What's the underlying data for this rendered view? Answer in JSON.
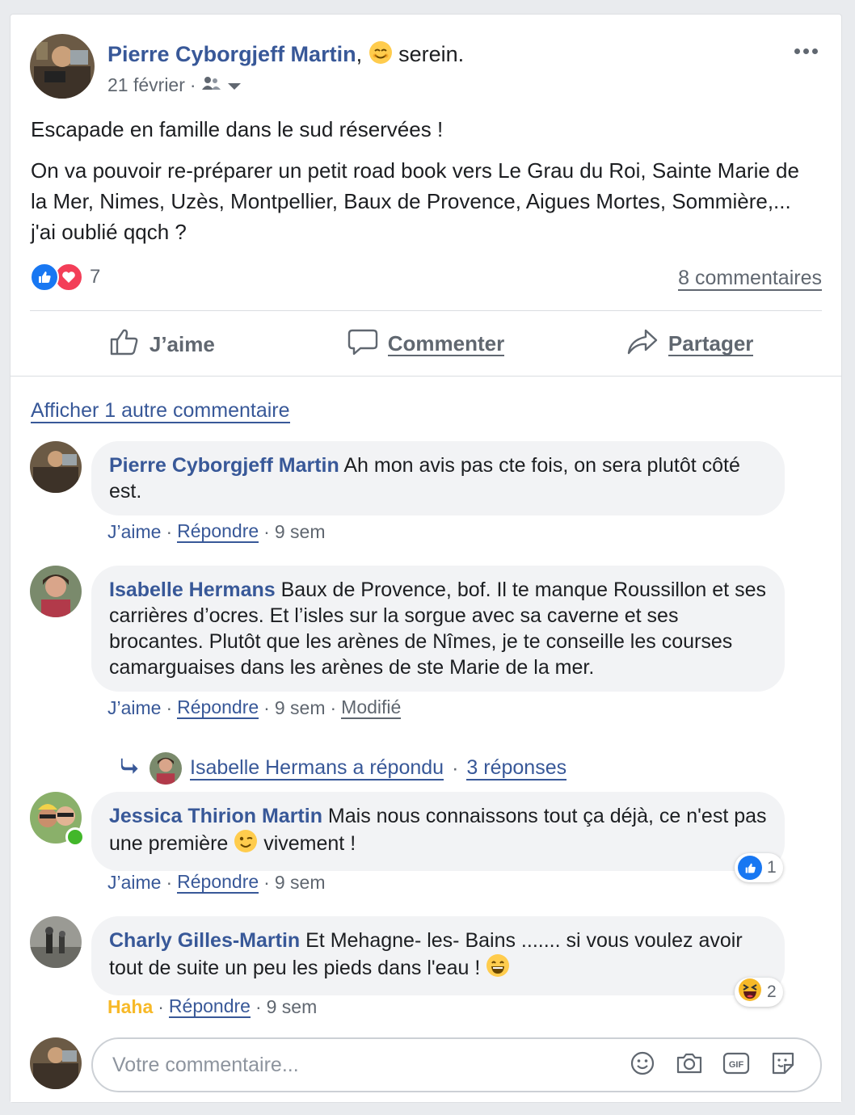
{
  "post": {
    "author": "Pierre Cyborgjeff Martin",
    "separator": ",",
    "feeling": "serein.",
    "date": "21 février",
    "dot": "·",
    "text_1": "Escapade en famille dans le sud réservées !",
    "text_2": "On va pouvoir re-préparer un petit road book vers Le Grau du Roi, Sainte Marie de la Mer, Nimes, Uzès, Montpellier, Baux de Provence, Aigues Mortes, Sommière,... j'ai oublié qqch ?",
    "reaction_count": "7",
    "comments_count": "8 commentaires"
  },
  "actions": {
    "like": "J’aime",
    "comment": "Commenter",
    "share": "Partager"
  },
  "show_more": "Afficher 1 autre commentaire",
  "comments": [
    {
      "author": "Pierre Cyborgjeff Martin",
      "text": "Ah mon avis pas cte fois, on sera plutôt côté est.",
      "like": "J’aime",
      "reply": "Répondre",
      "time": "9 sem"
    },
    {
      "author": "Isabelle Hermans",
      "text": "Baux de Provence, bof. Il te manque Roussillon et ses carrières d’ocres. Et l’isles sur la sorgue avec sa caverne et ses brocantes. Plutôt que les arènes de Nîmes, je te conseille les courses camarguaises dans les arènes de ste Marie de la mer.",
      "like": "J’aime",
      "reply": "Répondre",
      "time": "9 sem",
      "edited": "Modifié",
      "replied": "Isabelle Hermans a répondu",
      "replies": "3 réponses"
    },
    {
      "author": "Jessica Thirion Martin",
      "text_before": "Mais nous connaissons tout ça déjà, ce n'est pas une première",
      "text_after": "vivement !",
      "like": "J’aime",
      "reply": "Répondre",
      "time": "9 sem",
      "reaction_count": "1"
    },
    {
      "author": "Charly Gilles-Martin",
      "text": "Et Mehagne- les- Bains ....... si vous voulez avoir tout de suite un peu les pieds dans l'eau !",
      "like": "Haha",
      "reply": "Répondre",
      "time": "9 sem",
      "reaction_count": "2"
    }
  ],
  "composer": {
    "placeholder": "Votre commentaire..."
  },
  "colors": {
    "link": "#385898",
    "secondary": "#606770",
    "like_blue": "#1877f2",
    "love_red": "#f33e58",
    "haha_yellow": "#f7b928",
    "online_green": "#42b72a"
  },
  "icons": {
    "audience": "friends-icon",
    "more": "more-options-icon",
    "like": "thumbs-up-icon",
    "comment": "speech-bubble-icon",
    "share": "share-arrow-icon",
    "emoji": "emoji-icon",
    "camera": "camera-icon",
    "gif": "gif-icon",
    "sticker": "sticker-icon"
  }
}
